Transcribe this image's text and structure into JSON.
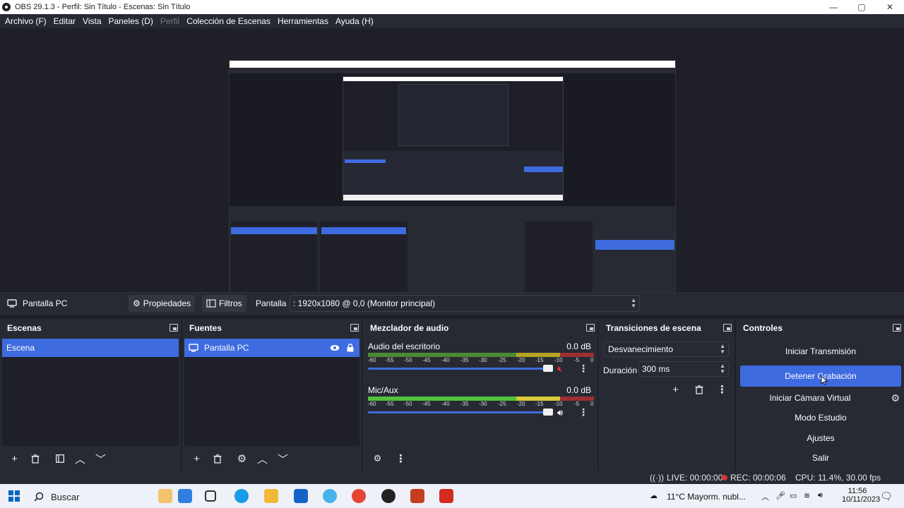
{
  "window": {
    "title": "OBS 29.1.3 - Perfil: Sin Título - Escenas: Sin Título",
    "min": "—",
    "max": "▢",
    "close": "✕"
  },
  "menu": [
    {
      "label": "Archivo (F)",
      "disabled": false
    },
    {
      "label": "Editar",
      "disabled": false
    },
    {
      "label": "Vista",
      "disabled": false
    },
    {
      "label": "Paneles (D)",
      "disabled": false
    },
    {
      "label": "Perfil",
      "disabled": true
    },
    {
      "label": "Colección de Escenas",
      "disabled": false
    },
    {
      "label": "Herramientas",
      "disabled": false
    },
    {
      "label": "Ayuda (H)",
      "disabled": false
    }
  ],
  "source_toolbar": {
    "source_name": "Pantalla PC",
    "properties_label": "Propiedades",
    "filters_label": "Filtros",
    "display_label": "Pantalla",
    "display_value": ": 1920x1080 @ 0,0 (Monitor principal)"
  },
  "scenes": {
    "title": "Escenas",
    "items": [
      "Escena"
    ]
  },
  "sources": {
    "title": "Fuentes",
    "items": [
      "Pantalla PC"
    ]
  },
  "mixer": {
    "title": "Mezclador de audio",
    "ticks": [
      "-60",
      "-55",
      "-50",
      "-45",
      "-40",
      "-35",
      "-30",
      "-25",
      "-20",
      "-15",
      "-10",
      "-5",
      "0"
    ],
    "channels": [
      {
        "name": "Audio del escritorio",
        "db": "0.0 dB",
        "muted": true,
        "volume": 1.0
      },
      {
        "name": "Mic/Aux",
        "db": "0.0 dB",
        "muted": false,
        "volume": 1.0
      }
    ]
  },
  "transitions": {
    "title": "Transiciones de escena",
    "selected": "Desvanecimiento",
    "duration_label": "Duración",
    "duration_value": "300 ms"
  },
  "controls": {
    "title": "Controles",
    "start_stream": "Iniciar Transmisión",
    "stop_recording": "Detener Grabación",
    "start_virtual_cam": "Iniciar Cámara Virtual",
    "studio_mode": "Modo Estudio",
    "settings": "Ajustes",
    "exit": "Salir"
  },
  "status": {
    "live": "LIVE: 00:00:00",
    "rec": "REC: 00:00:06",
    "cpu": "CPU: 11.4%, 30.00 fps"
  },
  "taskbar": {
    "search": "Buscar",
    "weather": "11°C  Mayorm. nubl...",
    "time": "11:56",
    "date": "10/11/2023"
  },
  "colors": {
    "accent": "#3f6be0",
    "background": "#1e1f29",
    "panel": "#272a33"
  }
}
